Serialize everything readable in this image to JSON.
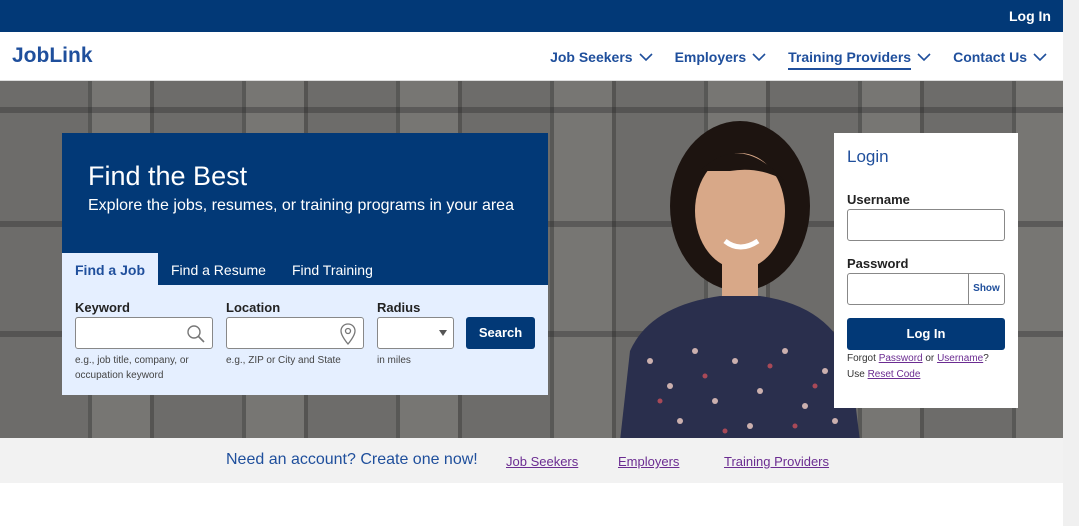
{
  "topbar": {
    "login_label": "Log In"
  },
  "header": {
    "brand": "JobLink",
    "nav": [
      {
        "label": "Job Seekers",
        "active": false
      },
      {
        "label": "Employers",
        "active": false
      },
      {
        "label": "Training Providers",
        "active": true
      },
      {
        "label": "Contact Us",
        "active": false
      }
    ]
  },
  "search": {
    "title": "Find the Best",
    "subtitle": "Explore the jobs, resumes, or training programs in your area",
    "tabs": [
      "Find a Job",
      "Find a Resume",
      "Find Training"
    ],
    "keyword": {
      "label": "Keyword",
      "value": "",
      "hint1": "e.g., job title, company, or",
      "hint2": "occupation keyword"
    },
    "location": {
      "label": "Location",
      "value": "",
      "hint": "e.g., ZIP or City and State"
    },
    "radius": {
      "label": "Radius",
      "value": "",
      "hint": "in miles"
    },
    "button_label": "Search"
  },
  "login": {
    "title": "Login",
    "username_label": "Username",
    "username_value": "",
    "password_label": "Password",
    "password_value": "",
    "show_label": "Show",
    "button_label": "Log In",
    "forgot_prefix": "Forgot",
    "forgot_password": "Password",
    "forgot_or": "or",
    "forgot_username": "Username",
    "forgot_suffix": "?",
    "use_prefix": "Use",
    "reset_code": "Reset Code"
  },
  "account_bar": {
    "text": "Need an account? Create one now!",
    "links": [
      "Job Seekers",
      "Employers",
      "Training Providers"
    ]
  },
  "colors": {
    "brand_blue": "#023977",
    "link_blue": "#1f4f9c",
    "visited_purple": "#6b2c91",
    "panel_blue": "#e5efff"
  }
}
